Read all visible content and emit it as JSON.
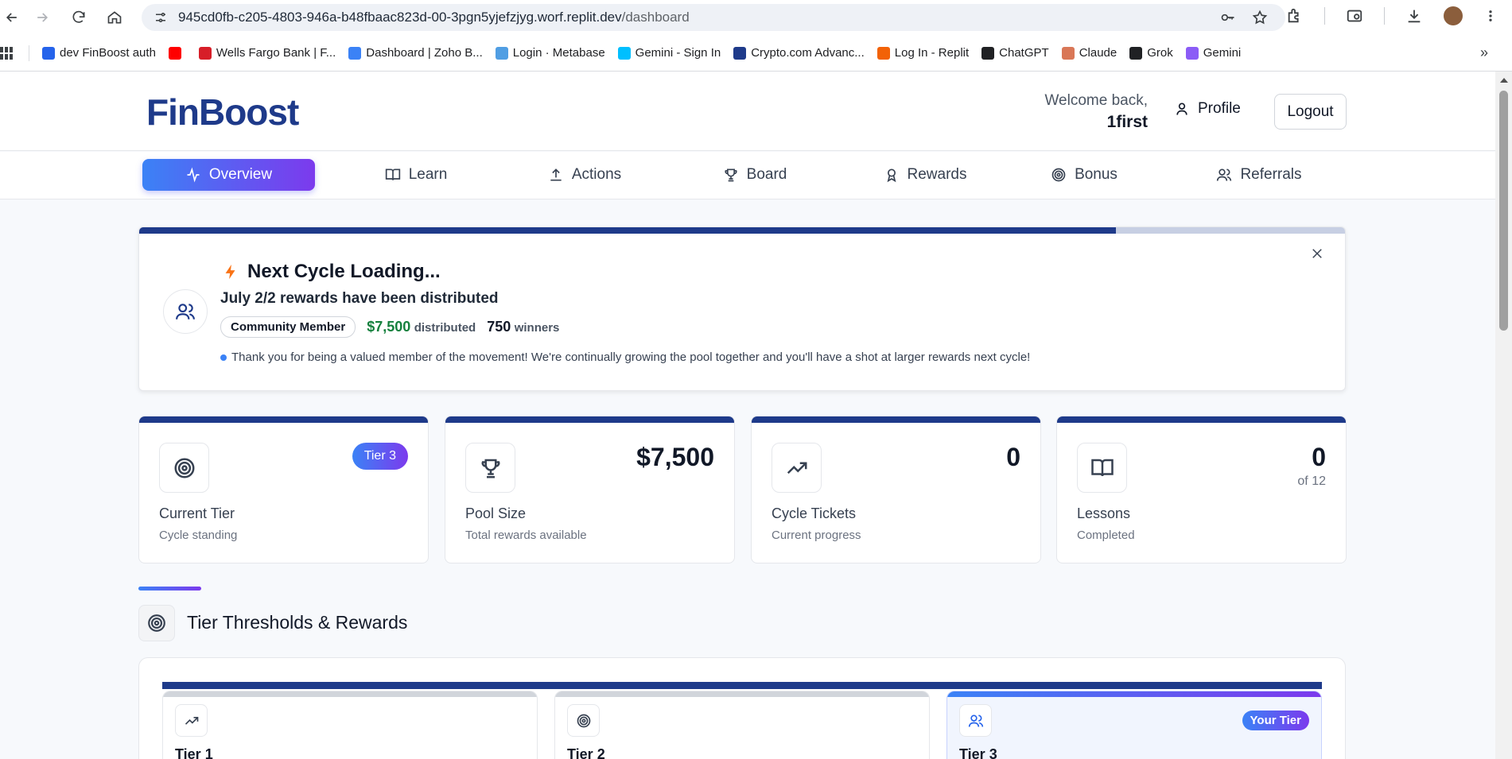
{
  "browser": {
    "url_host": "945cd0fb-c205-4803-946a-b48fbaac823d-00-3pgn5yjefzjyg.worf.replit.dev",
    "url_path": "/dashboard",
    "bookmarks": [
      {
        "label": "dev FinBoost auth",
        "color": "#2563eb"
      },
      {
        "label": "",
        "color": "#ff0000"
      },
      {
        "label": "Wells Fargo Bank | F...",
        "color": "#d71e28"
      },
      {
        "label": "Dashboard | Zoho B...",
        "color": "#3b82f6"
      },
      {
        "label": "Login · Metabase",
        "color": "#509ee3"
      },
      {
        "label": "Gemini - Sign In",
        "color": "#00bfff"
      },
      {
        "label": "Crypto.com Advanc...",
        "color": "#1e3a8a"
      },
      {
        "label": "Log In - Replit",
        "color": "#f26207"
      },
      {
        "label": "ChatGPT",
        "color": "#202124"
      },
      {
        "label": "Claude",
        "color": "#d97757"
      },
      {
        "label": "Grok",
        "color": "#202124"
      },
      {
        "label": "Gemini",
        "color": "#8b5cf6"
      }
    ]
  },
  "header": {
    "logo": "FinBoost",
    "welcome_label": "Welcome back,",
    "username": "1first",
    "profile_label": "Profile",
    "logout_label": "Logout"
  },
  "tabs": [
    {
      "label": "Overview",
      "icon": "activity-icon",
      "active": true
    },
    {
      "label": "Learn",
      "icon": "book-icon",
      "active": false
    },
    {
      "label": "Actions",
      "icon": "upload-icon",
      "active": false
    },
    {
      "label": "Board",
      "icon": "trophy-icon",
      "active": false
    },
    {
      "label": "Rewards",
      "icon": "award-icon",
      "active": false
    },
    {
      "label": "Bonus",
      "icon": "target-icon",
      "active": false
    },
    {
      "label": "Referrals",
      "icon": "users-icon",
      "active": false
    }
  ],
  "banner": {
    "title": "Next Cycle Loading...",
    "subtitle": "July 2/2 rewards have been distributed",
    "badge": "Community Member",
    "amount": "$7,500",
    "amount_label": "distributed",
    "winners_count": "750",
    "winners_label": "winners",
    "note": "Thank you for being a valued member of the movement! We're continually growing the pool together and you'll have a shot at larger rewards next cycle!",
    "progress_percent": 81
  },
  "stats": [
    {
      "title": "Current Tier",
      "desc": "Cycle standing",
      "badge": "Tier 3",
      "icon": "target-icon"
    },
    {
      "title": "Pool Size",
      "desc": "Total rewards available",
      "value": "$7,500",
      "icon": "trophy-icon"
    },
    {
      "title": "Cycle Tickets",
      "desc": "Current progress",
      "value": "0",
      "icon": "trending-up-icon"
    },
    {
      "title": "Lessons",
      "desc": "Completed",
      "value": "0",
      "value_sub": "of 12",
      "icon": "book-icon"
    }
  ],
  "tier_section": {
    "title": "Tier Thresholds & Rewards",
    "tiers": [
      {
        "name": "Tier 1",
        "icon": "trending-up-icon"
      },
      {
        "name": "Tier 2",
        "icon": "target-icon"
      },
      {
        "name": "Tier 3",
        "icon": "users-icon",
        "badge": "Your Tier"
      }
    ]
  }
}
